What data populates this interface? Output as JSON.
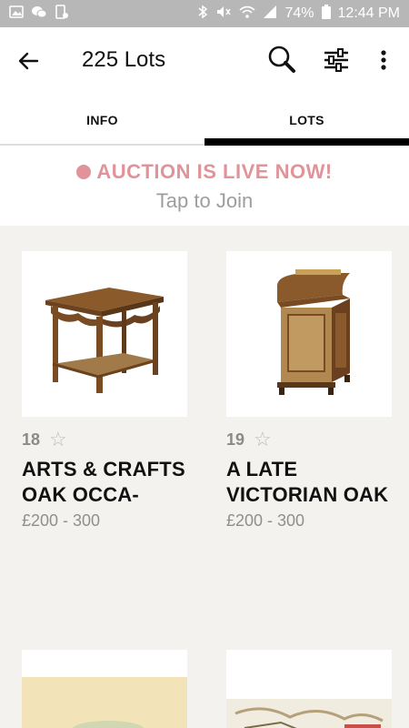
{
  "status_bar": {
    "battery": "74%",
    "time": "12:44 PM"
  },
  "app_bar": {
    "title": "225 Lots"
  },
  "tabs": [
    {
      "label": "INFO"
    },
    {
      "label": "LOTS"
    }
  ],
  "live_banner": {
    "headline": "AUCTION IS LIVE NOW!",
    "subtext": "Tap to Join",
    "color": "#e0949a"
  },
  "lots": [
    {
      "number": "18",
      "title_line1": "ARTS & CRAFTS",
      "title_line2": "OAK OCCA-",
      "price": "£200 - 300"
    },
    {
      "number": "19",
      "title_line1": "A LATE",
      "title_line2": "VICTORIAN OAK",
      "price": "£200 - 300"
    }
  ]
}
